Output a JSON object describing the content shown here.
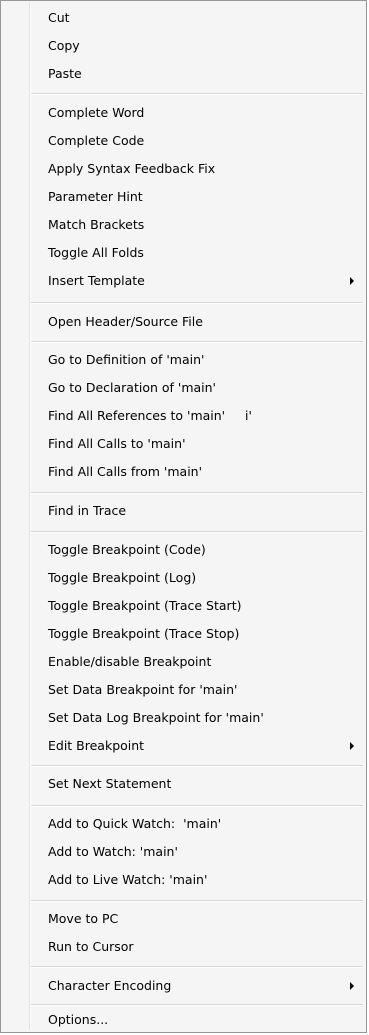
{
  "menu": {
    "items": [
      {
        "label": "Cut"
      },
      {
        "label": "Copy"
      },
      {
        "label": "Paste"
      },
      {
        "label": "Complete Word"
      },
      {
        "label": "Complete Code"
      },
      {
        "label": "Apply Syntax Feedback Fix"
      },
      {
        "label": "Parameter Hint"
      },
      {
        "label": "Match Brackets"
      },
      {
        "label": "Toggle All Folds"
      },
      {
        "label": "Insert Template",
        "submenu": true
      },
      {
        "label": "Open Header/Source File"
      },
      {
        "label": "Go to Definition of 'main'"
      },
      {
        "label": "Go to Declaration of 'main'"
      },
      {
        "label": "Find All References to 'main'     i'"
      },
      {
        "label": "Find All Calls to 'main'"
      },
      {
        "label": "Find All Calls from 'main'"
      },
      {
        "label": "Find in Trace"
      },
      {
        "label": "Toggle Breakpoint (Code)"
      },
      {
        "label": "Toggle Breakpoint (Log)"
      },
      {
        "label": "Toggle Breakpoint (Trace Start)"
      },
      {
        "label": "Toggle Breakpoint (Trace Stop)"
      },
      {
        "label": "Enable/disable Breakpoint"
      },
      {
        "label": "Set Data Breakpoint for 'main'"
      },
      {
        "label": "Set Data Log Breakpoint for 'main'"
      },
      {
        "label": "Edit Breakpoint",
        "submenu": true
      },
      {
        "label": "Set Next Statement"
      },
      {
        "label": "Add to Quick Watch:  'main'"
      },
      {
        "label": "Add to Watch: 'main'"
      },
      {
        "label": "Add to Live Watch: 'main'"
      },
      {
        "label": "Move to PC"
      },
      {
        "label": "Run to Cursor"
      },
      {
        "label": "Character Encoding",
        "submenu": true
      },
      {
        "label": "Options..."
      }
    ]
  }
}
